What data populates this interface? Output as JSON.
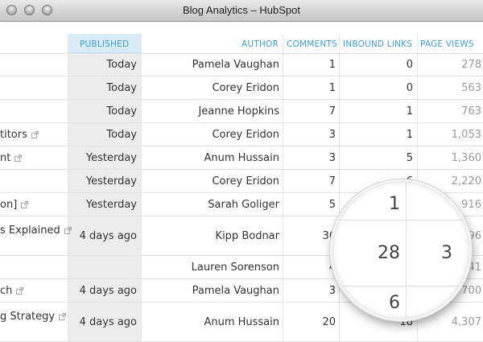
{
  "window": {
    "title": "Blog Analytics – HubSpot"
  },
  "columns": {
    "published": "PUBLISHED",
    "author": "AUTHOR",
    "comments": "COMMENTS",
    "inbound_links": "INBOUND LINKS",
    "page_views": "PAGE VIEWS"
  },
  "rows": [
    {
      "title": "",
      "published": "Today",
      "author": "Pamela Vaughan",
      "comments": "1",
      "inbound": "0",
      "views": "278"
    },
    {
      "title": "",
      "published": "Today",
      "author": "Corey Eridon",
      "comments": "1",
      "inbound": "0",
      "views": "563"
    },
    {
      "title": "",
      "published": "Today",
      "author": "Jeanne Hopkins",
      "comments": "7",
      "inbound": "1",
      "views": "763"
    },
    {
      "title": "titors",
      "published": "Today",
      "author": "Corey Eridon",
      "comments": "3",
      "inbound": "1",
      "views": "1,053"
    },
    {
      "title": "nt",
      "published": "Yesterday",
      "author": "Anum Hussain",
      "comments": "3",
      "inbound": "5",
      "views": "1,360"
    },
    {
      "title": "",
      "published": "Yesterday",
      "author": "Corey Eridon",
      "comments": "7",
      "inbound": "6",
      "views": "2,220"
    },
    {
      "title": "on]",
      "published": "Yesterday",
      "author": "Sarah Goliger",
      "comments": "5",
      "inbound": "",
      "views": "916"
    },
    {
      "title": "s Explained",
      "published": "4 days ago",
      "author": "Kipp Bodnar",
      "comments": "36",
      "inbound": "",
      "views": "796"
    },
    {
      "title": "",
      "published": "",
      "author": "Lauren Sorenson",
      "comments": "4",
      "inbound": "",
      "views": "241"
    },
    {
      "title": "ch",
      "published": "4 days ago",
      "author": "Pamela Vaughan",
      "comments": "3",
      "inbound": "",
      "views": "700"
    },
    {
      "title": "g Strategy",
      "published": "4 days ago",
      "author": "Anum Hussain",
      "comments": "20",
      "inbound": "18",
      "views": "4,307"
    }
  ],
  "magnifier": {
    "top_value": "1",
    "center_value": "28",
    "right_value": "3",
    "bottom_value": "6"
  }
}
